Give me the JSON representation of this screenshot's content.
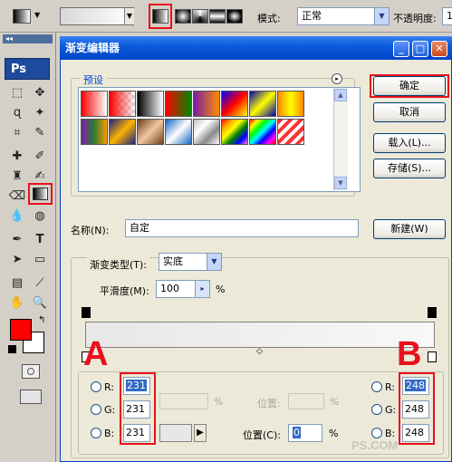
{
  "options_bar": {
    "mode_label": "模式:",
    "mode_value": "正常",
    "opacity_label": "不透明度:",
    "opacity_value": "1"
  },
  "toolbox": {
    "logo": "Ps",
    "header": "◂◂",
    "foreground_color": "#ff0000",
    "background_color": "#ffffff"
  },
  "dialog": {
    "title": "渐变编辑器",
    "presets_label": "预设",
    "buttons": {
      "ok": "确定",
      "cancel": "取消",
      "load": "载入(L)...",
      "save": "存储(S)..."
    },
    "name_label": "名称(N):",
    "name_value": "自定",
    "new_button": "新建(W)",
    "gradient_type_label": "渐变类型(T):",
    "gradient_type_value": "实底",
    "smoothness_label": "平滑度(M):",
    "smoothness_value": "100",
    "smoothness_unit": "%",
    "position_label_disabled": "位置:",
    "percent": "%",
    "position_label": "位置(C):",
    "position_value": "0"
  },
  "annotations": {
    "left_letter": "A",
    "right_letter": "B"
  },
  "left_rgb": {
    "r_label": "R:",
    "r": "231",
    "g_label": "G:",
    "g": "231",
    "b_label": "B:",
    "b": "231"
  },
  "right_rgb": {
    "r_label": "R:",
    "r": "248",
    "g_label": "G:",
    "g": "248",
    "b_label": "B:",
    "b": "248"
  },
  "watermark": "PS.COM"
}
